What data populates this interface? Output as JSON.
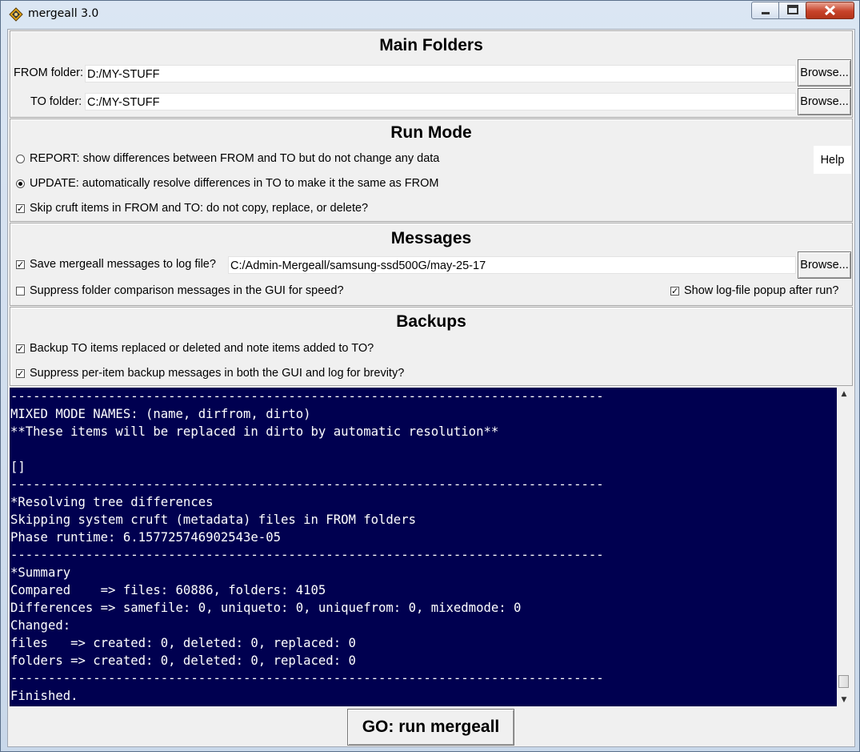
{
  "window": {
    "title": "mergeall 3.0"
  },
  "main_folders": {
    "title": "Main Folders",
    "from_label": "FROM folder:",
    "from_value": "D:/MY-STUFF",
    "to_label": "TO folder:",
    "to_value": "C:/MY-STUFF",
    "browse_label": "Browse..."
  },
  "run_mode": {
    "title": "Run Mode",
    "report_label": "REPORT: show differences between FROM and TO but do not change any data",
    "update_label": "UPDATE: automatically resolve differences in TO to make it the same as FROM",
    "skip_cruft_label": "Skip cruft items in FROM and TO: do not copy, replace, or delete?",
    "help_label": "Help",
    "selected": "UPDATE",
    "skip_cruft_checked": true
  },
  "messages": {
    "title": "Messages",
    "save_log_label": "Save mergeall messages to log file?",
    "log_path": "C:/Admin-Mergeall/samsung-ssd500G/may-25-17",
    "browse_label": "Browse...",
    "suppress_label": "Suppress folder comparison messages in the GUI for speed?",
    "show_popup_label": "Show log-file popup after run?",
    "save_log_checked": true,
    "suppress_checked": false,
    "show_popup_checked": true
  },
  "backups": {
    "title": "Backups",
    "backup_label": "Backup TO items replaced or deleted and note items added to TO?",
    "suppress_label": "Suppress per-item backup messages in both the GUI and log for brevity?",
    "backup_checked": true,
    "suppress_checked": true
  },
  "console": {
    "lines": [
      "-------------------------------------------------------------------------------",
      "MIXED MODE NAMES: (name, dirfrom, dirto)",
      "**These items will be replaced in dirto by automatic resolution**",
      "",
      "[]",
      "-------------------------------------------------------------------------------",
      "*Resolving tree differences",
      "Skipping system cruft (metadata) files in FROM folders",
      "Phase runtime: 6.157725746902543e-05",
      "-------------------------------------------------------------------------------",
      "*Summary",
      "Compared    => files: 60886, folders: 4105",
      "Differences => samefile: 0, uniqueto: 0, uniquefrom: 0, mixedmode: 0",
      "Changed:",
      "files   => created: 0, deleted: 0, replaced: 0",
      "folders => created: 0, deleted: 0, replaced: 0",
      "-------------------------------------------------------------------------------",
      "Finished."
    ],
    "bg_color": "#000050",
    "fg_color": "#ffffff"
  },
  "go_button": {
    "label": "GO: run mergeall"
  }
}
